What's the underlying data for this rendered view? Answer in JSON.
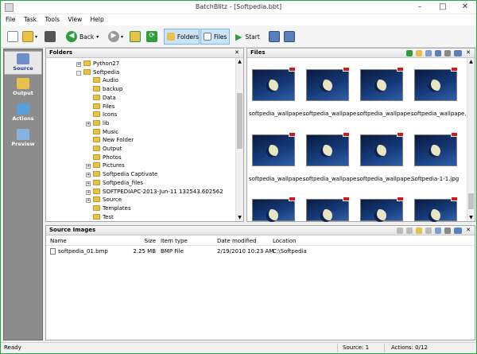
{
  "window": {
    "title": "BatchBlitz - [Softpedia.bbt]"
  },
  "menu": [
    "File",
    "Task",
    "Tools",
    "View",
    "Help"
  ],
  "toolbar": {
    "back": "Back",
    "folders": "Folders",
    "files": "Files",
    "start": "Start"
  },
  "sidebar": {
    "items": [
      {
        "label": "Source"
      },
      {
        "label": "Output"
      },
      {
        "label": "Actions"
      },
      {
        "label": "Preview"
      }
    ]
  },
  "folders_panel": {
    "title": "Folders",
    "items": [
      "Python27",
      "Softpedia",
      "Audio",
      "backup",
      "Data",
      "Files",
      "Icons",
      "lib",
      "Music",
      "New Folder",
      "Output",
      "Photos",
      "Pictures",
      "Softpedia Captivate",
      "Softpedia_files",
      "SOFTPEDIAPC-2013-Jun-11 132543.602562",
      "Source",
      "Templates",
      "Test"
    ]
  },
  "files_panel": {
    "title": "Files",
    "labels": [
      "softpedia_wallpape...",
      "softpedia_wallpape...",
      "softpedia_wallpape...",
      "softpedia_wallpape...",
      "softpedia_wallpape...",
      "softpedia_wallpape...",
      "softpedia_wallpape...",
      "Softpedia-1-1.jpg"
    ]
  },
  "source_panel": {
    "title": "Source Images",
    "columns": {
      "name": "Name",
      "size": "Size",
      "type": "Item type",
      "date": "Date modified",
      "location": "Location"
    },
    "row": {
      "name": "softpedia_01.bmp",
      "size": "2.25 MB",
      "type": "BMP File",
      "date": "2/19/2010 10:23 AM",
      "location": "C:\\Softpedia"
    }
  },
  "status": {
    "left": "Ready",
    "source": "Source: 1",
    "actions": "Actions: 0/12"
  },
  "colors": {
    "frame": "#2aa44a",
    "sidebar": "#8c8c8c",
    "folder": "#e8c14a"
  }
}
